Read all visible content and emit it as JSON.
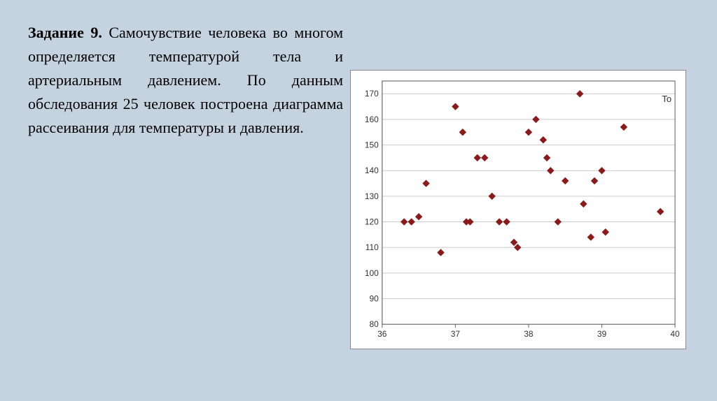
{
  "text": {
    "task_label": "Задание 9.",
    "description": " Самочувствие человека во многом определяется температурой тела и артериальным давлением. По данным обследования 25 человек построена диаграмма рассеивания для температуры и давления."
  },
  "chart": {
    "x_min": 36,
    "x_max": 40,
    "y_min": 80,
    "y_max": 175,
    "x_ticks": [
      36,
      37,
      38,
      39,
      40
    ],
    "y_ticks": [
      80,
      90,
      100,
      110,
      120,
      130,
      140,
      150,
      160,
      170
    ],
    "points": [
      [
        36.3,
        120
      ],
      [
        36.4,
        120
      ],
      [
        36.5,
        122
      ],
      [
        36.6,
        135
      ],
      [
        36.8,
        108
      ],
      [
        37.0,
        165
      ],
      [
        37.1,
        155
      ],
      [
        37.15,
        120
      ],
      [
        37.2,
        120
      ],
      [
        37.3,
        145
      ],
      [
        37.4,
        145
      ],
      [
        37.5,
        130
      ],
      [
        37.6,
        120
      ],
      [
        37.7,
        120
      ],
      [
        37.8,
        112
      ],
      [
        37.85,
        110
      ],
      [
        38.0,
        155
      ],
      [
        38.1,
        160
      ],
      [
        38.2,
        152
      ],
      [
        38.25,
        145
      ],
      [
        38.3,
        140
      ],
      [
        38.4,
        120
      ],
      [
        38.5,
        136
      ],
      [
        38.7,
        170
      ],
      [
        38.75,
        127
      ],
      [
        38.85,
        114
      ],
      [
        38.9,
        136
      ],
      [
        39.0,
        140
      ],
      [
        39.05,
        116
      ],
      [
        39.3,
        157
      ],
      [
        39.8,
        124
      ]
    ]
  }
}
